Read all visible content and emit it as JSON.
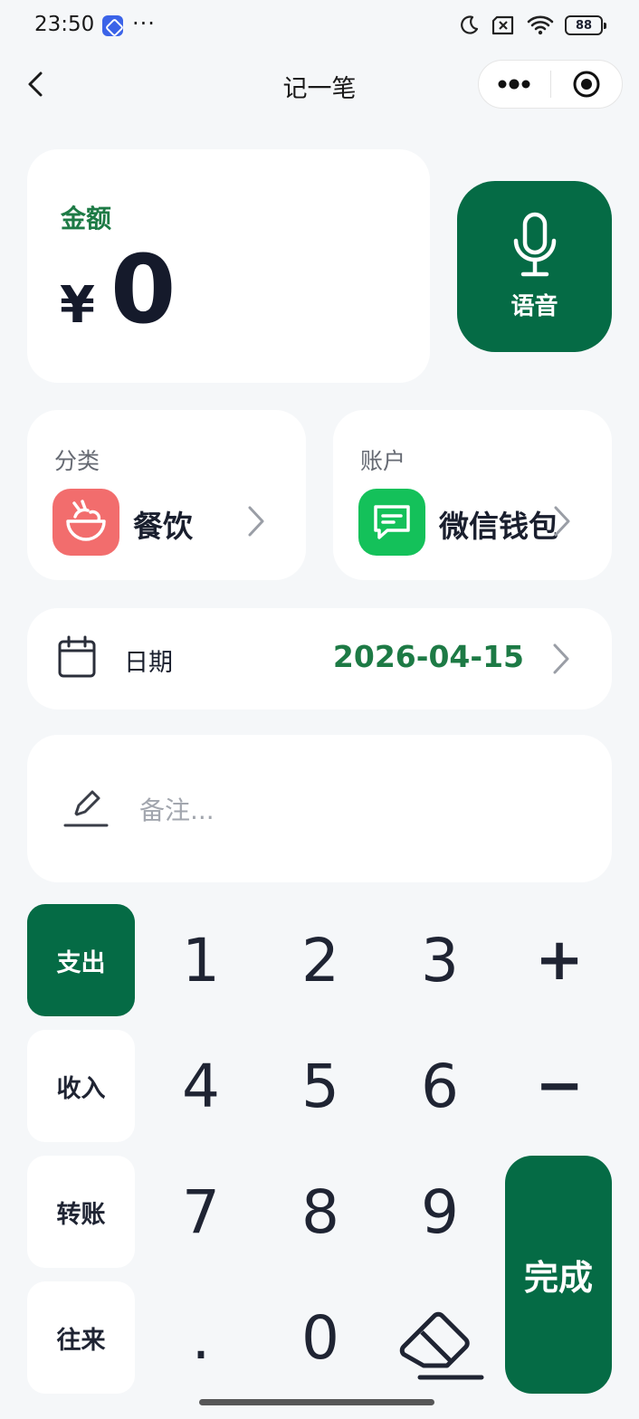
{
  "status_bar": {
    "time": "23:50",
    "battery": "88"
  },
  "nav": {
    "title": "记一笔"
  },
  "amount": {
    "label": "金额",
    "currency": "¥",
    "value": "0"
  },
  "voice": {
    "label": "语音"
  },
  "category": {
    "label": "分类",
    "value": "餐饮"
  },
  "account": {
    "label": "账户",
    "value": "微信钱包"
  },
  "date": {
    "label": "日期",
    "value": "2026-04-15"
  },
  "note": {
    "placeholder": "备注..."
  },
  "types": [
    "支出",
    "收入",
    "转账",
    "往来"
  ],
  "keypad": {
    "k1": "1",
    "k2": "2",
    "k3": "3",
    "plus": "+",
    "k4": "4",
    "k5": "5",
    "k6": "6",
    "minus": "−",
    "k7": "7",
    "k8": "8",
    "k9": "9",
    "dot": ".",
    "k0": "0"
  },
  "done": {
    "label": "完成"
  },
  "colors": {
    "primary": "#056b45",
    "accent_text": "#1d7a45",
    "category_icon_bg": "#f26d6d",
    "account_icon_bg": "#14c15a"
  },
  "icons": [
    "back-icon",
    "more-icon",
    "record-icon",
    "microphone-icon",
    "bowl-icon",
    "wechat-wallet-icon",
    "calendar-icon",
    "pencil-icon",
    "eraser-icon",
    "chevron-right-icon"
  ]
}
